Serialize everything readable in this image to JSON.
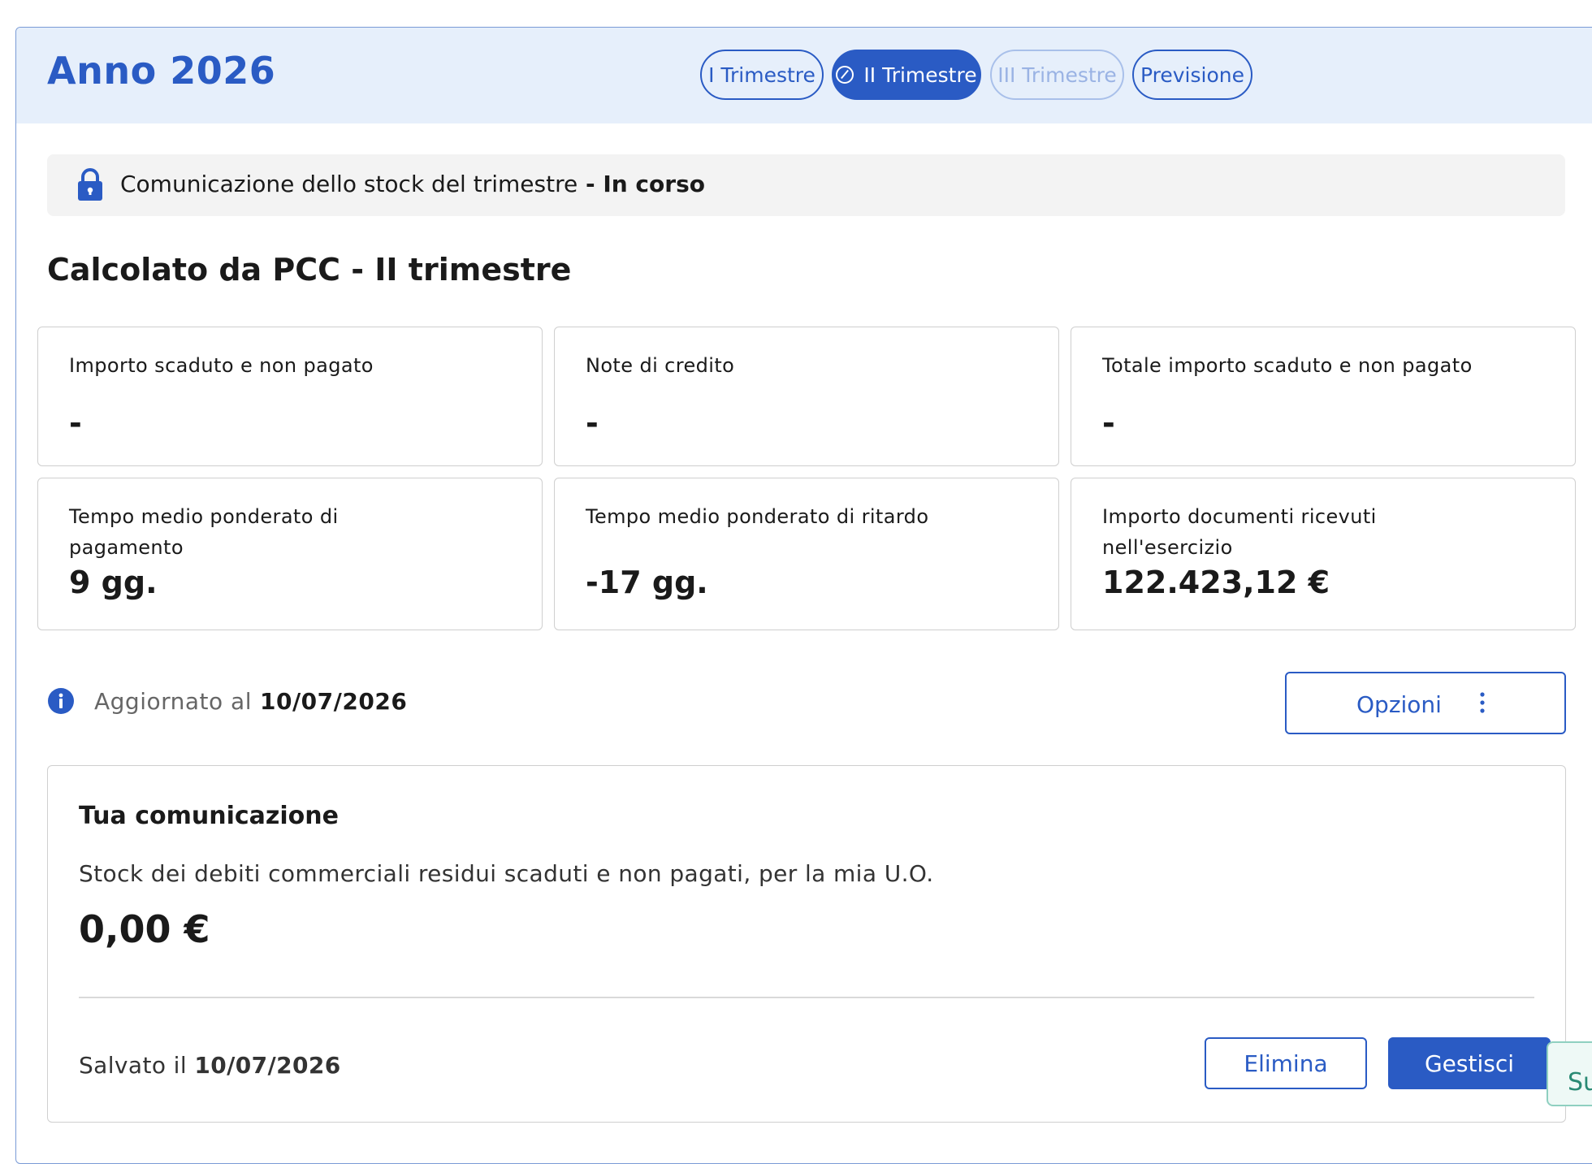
{
  "header": {
    "title": "Anno 2026",
    "tabs": [
      {
        "label": "I Trimestre",
        "state": "default"
      },
      {
        "label": "II Trimestre",
        "state": "active"
      },
      {
        "label": "III Trimestre",
        "state": "disabled"
      },
      {
        "label": "Previsione",
        "state": "default"
      }
    ]
  },
  "status": {
    "text": "Comunicazione dello stock del trimestre",
    "separator": " - ",
    "state": "In corso",
    "icon": "lock-icon"
  },
  "section": {
    "title": "Calcolato da PCC - II trimestre"
  },
  "cards": [
    {
      "label": "Importo scaduto e non pagato",
      "value": "-"
    },
    {
      "label": "Note di credito",
      "value": "-"
    },
    {
      "label": "Totale importo scaduto e non pagato",
      "value": "-"
    },
    {
      "label": "Tempo medio ponderato di pagamento",
      "value": "9 gg."
    },
    {
      "label": "Tempo medio ponderato di ritardo",
      "value": "-17 gg."
    },
    {
      "label": "Importo documenti ricevuti nell'esercizio",
      "value": "122.423,12 €"
    }
  ],
  "updated": {
    "label": "Aggiornato al",
    "date": "10/07/2026",
    "icon": "info-icon"
  },
  "options": {
    "label": "Opzioni",
    "icon": "more-vertical-icon"
  },
  "communication": {
    "title": "Tua comunicazione",
    "description": "Stock dei debiti commerciali residui scaduti e non pagati, per la mia U.O.",
    "amount": "0,00 €",
    "saved_label": "Salvato il",
    "saved_date": "10/07/2026",
    "delete_label": "Elimina",
    "manage_label": "Gestisci"
  },
  "floating_button": {
    "label": "Su"
  },
  "colors": {
    "primary": "#2a5bc4",
    "header_bg": "#e6effb",
    "status_bg": "#f3f3f3",
    "card_border": "#cfcfcf",
    "floating_accent": "#2a8a74"
  }
}
